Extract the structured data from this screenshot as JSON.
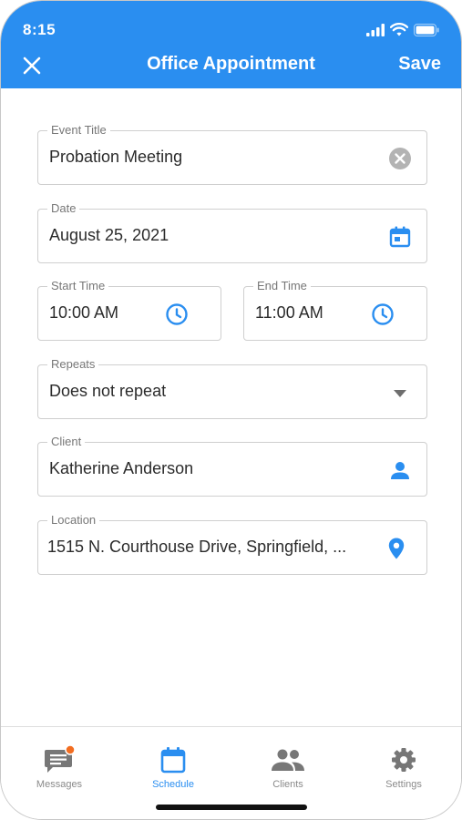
{
  "status_bar": {
    "time": "8:15"
  },
  "header": {
    "title": "Office Appointment",
    "save_label": "Save"
  },
  "form": {
    "event_title": {
      "label": "Event Title",
      "value": "Probation Meeting"
    },
    "date": {
      "label": "Date",
      "value": "August 25, 2021"
    },
    "start_time": {
      "label": "Start Time",
      "value": "10:00 AM"
    },
    "end_time": {
      "label": "End Time",
      "value": "11:00 AM"
    },
    "repeats": {
      "label": "Repeats",
      "value": "Does not repeat"
    },
    "client": {
      "label": "Client",
      "value": "Katherine Anderson"
    },
    "location": {
      "label": "Location",
      "value": "1515 N. Courthouse Drive, Springfield, ..."
    }
  },
  "bottom_nav": {
    "items": [
      {
        "label": "Messages",
        "icon": "message-icon",
        "has_badge": true
      },
      {
        "label": "Schedule",
        "icon": "calendar-icon",
        "active": true
      },
      {
        "label": "Clients",
        "icon": "people-icon"
      },
      {
        "label": "Settings",
        "icon": "gear-icon"
      }
    ]
  },
  "colors": {
    "accent": "#2a8ef0",
    "badge": "#f26d21",
    "inactive_icon": "#777777"
  }
}
